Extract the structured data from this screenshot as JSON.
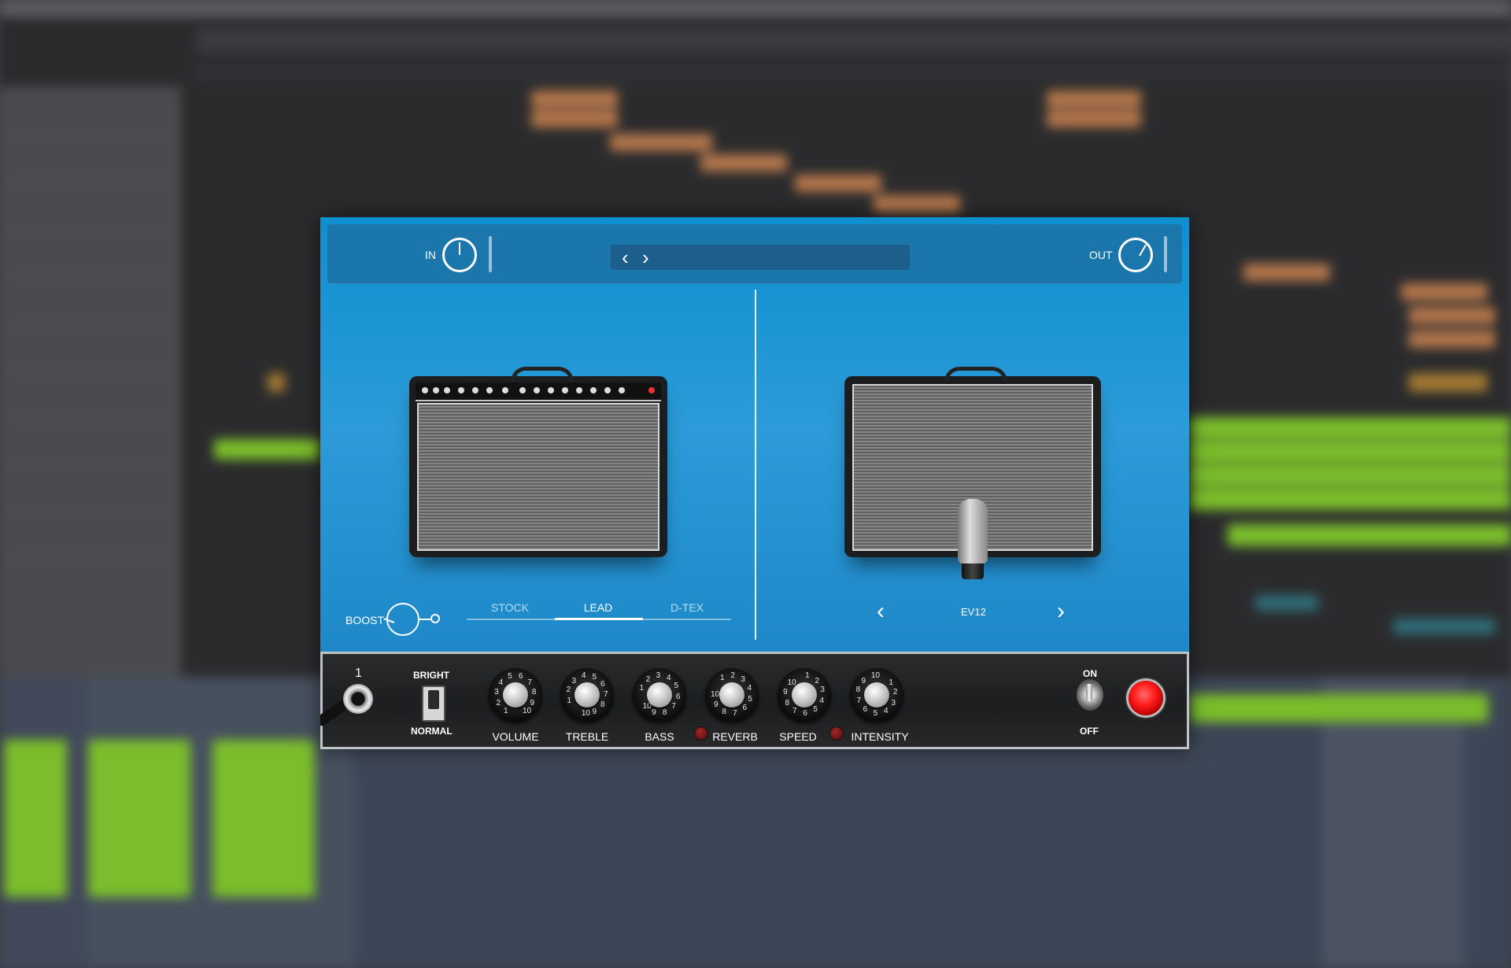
{
  "plugin": {
    "header": {
      "in_label": "IN",
      "out_label": "OUT",
      "preset_name": ""
    },
    "amp": {
      "boost_label": "BOOST",
      "channels": [
        "STOCK",
        "LEAD",
        "D-TEX"
      ],
      "selected_channel": "LEAD"
    },
    "cabinet": {
      "name": "EV12"
    },
    "controls": {
      "input_number": "1",
      "bright_label": "BRIGHT",
      "normal_label": "NORMAL",
      "knobs": [
        "VOLUME",
        "TREBLE",
        "BASS",
        "REVERB",
        "SPEED",
        "INTENSITY"
      ],
      "on_label": "ON",
      "off_label": "OFF"
    },
    "knob_scale": [
      "1",
      "2",
      "3",
      "4",
      "5",
      "6",
      "7",
      "8",
      "9",
      "10"
    ],
    "colors": {
      "accent": "#1b8fd2",
      "power_led": "#ff1a1a",
      "daw_clip_orange": "#b3764b",
      "daw_clip_green": "#7bbd2c"
    }
  }
}
